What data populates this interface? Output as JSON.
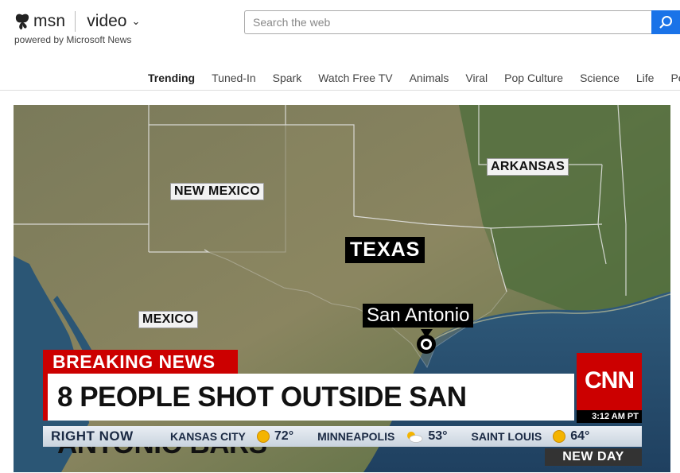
{
  "header": {
    "brand": "msn",
    "section": "video",
    "powered_by": "powered by Microsoft News",
    "search_placeholder": "Search the web",
    "search_icon": "search-icon",
    "dropdown_icon": "chevron-down-icon"
  },
  "nav": {
    "items": [
      {
        "label": "Trending",
        "active": true
      },
      {
        "label": "Tuned-In"
      },
      {
        "label": "Spark"
      },
      {
        "label": "Watch Free TV"
      },
      {
        "label": "Animals"
      },
      {
        "label": "Viral"
      },
      {
        "label": "Pop Culture"
      },
      {
        "label": "Science"
      },
      {
        "label": "Life"
      },
      {
        "label": "People"
      }
    ]
  },
  "video": {
    "map_labels": {
      "new_mexico": "NEW MEXICO",
      "arkansas": "ARKANSAS",
      "mexico": "MEXICO",
      "texas": "TEXAS",
      "city": "San Antonio"
    },
    "breaking": "BREAKING NEWS",
    "headline": "8 PEOPLE SHOT OUTSIDE SAN ANTONIO BARS",
    "network": "CNN",
    "time": "3:12 AM PT",
    "ticker": {
      "label": "RIGHT NOW",
      "items": [
        {
          "city": "KANSAS CITY",
          "temp": "72°",
          "icon": "sun-icon"
        },
        {
          "city": "MINNEAPOLIS",
          "temp": "53°",
          "icon": "partly-cloudy-icon"
        },
        {
          "city": "SAINT LOUIS",
          "temp": "64°",
          "icon": "sun-icon"
        }
      ]
    },
    "show": "NEW DAY"
  },
  "colors": {
    "accent_blue": "#1a73e8",
    "cnn_red": "#cc0000"
  }
}
